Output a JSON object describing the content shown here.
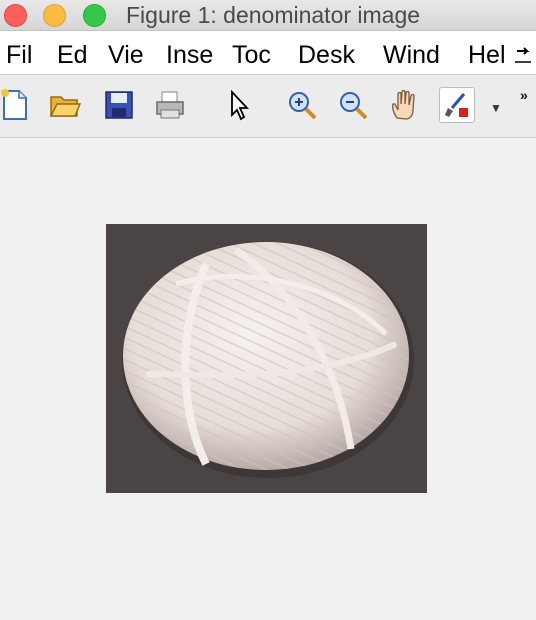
{
  "window": {
    "title": "Figure 1: denominator image"
  },
  "menubar": {
    "items": [
      "Fil",
      "Ed",
      "Vie",
      "Inse",
      "Toc",
      "Desk",
      "Wind",
      "Hel"
    ]
  },
  "toolbar": {
    "icons": [
      "new-file-icon",
      "open-folder-icon",
      "save-icon",
      "print-icon",
      "pointer-icon",
      "zoom-in-icon",
      "zoom-out-icon",
      "pan-hand-icon",
      "brush-icon",
      "dropdown-icon",
      "overflow-icon"
    ]
  },
  "figure": {
    "image_subject": "ball of white twine on dark background"
  },
  "colors": {
    "close": "#fc605b",
    "minimize": "#fdbc40",
    "maximize": "#34c84a",
    "background": "#ececec"
  }
}
